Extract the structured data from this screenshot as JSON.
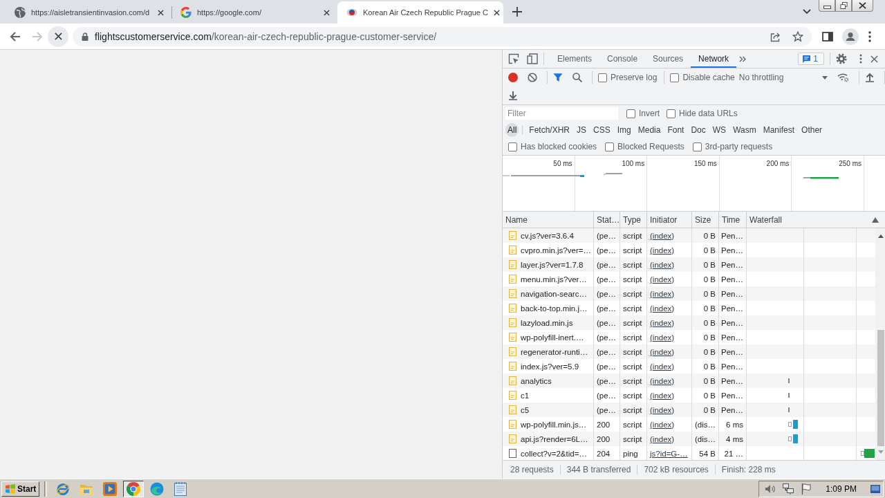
{
  "browser_tabs": [
    {
      "title": "https://aisletransientinvasion.com/d",
      "kind": "globe",
      "selected": false
    },
    {
      "title": "https://google.com/",
      "kind": "google",
      "selected": false
    },
    {
      "title": "Korean Air Czech Republic Prague C",
      "kind": "airline",
      "selected": true
    }
  ],
  "address_bar": {
    "loading": true,
    "host": "flightscustomerservice.com",
    "path": "/korean-air-czech-republic-prague-customer-service/"
  },
  "devtools": {
    "panel_tabs": [
      {
        "label": "Elements",
        "selected": false
      },
      {
        "label": "Console",
        "selected": false
      },
      {
        "label": "Sources",
        "selected": false
      },
      {
        "label": "Network",
        "selected": true
      }
    ],
    "issues_count": "1",
    "recording": true,
    "toolbar_options": [
      {
        "label": "Preserve log",
        "checked": false
      },
      {
        "label": "Disable cache",
        "checked": false
      }
    ],
    "throttling": "No throttling",
    "filter": {
      "placeholder": "Filter",
      "options": [
        {
          "label": "Invert",
          "checked": false
        },
        {
          "label": "Hide data URLs",
          "checked": false
        }
      ]
    },
    "type_filters": [
      {
        "label": "All",
        "selected": true
      },
      {
        "label": "Fetch/XHR",
        "selected": false
      },
      {
        "label": "JS",
        "selected": false
      },
      {
        "label": "CSS",
        "selected": false
      },
      {
        "label": "Img",
        "selected": false
      },
      {
        "label": "Media",
        "selected": false
      },
      {
        "label": "Font",
        "selected": false
      },
      {
        "label": "Doc",
        "selected": false
      },
      {
        "label": "WS",
        "selected": false
      },
      {
        "label": "Wasm",
        "selected": false
      },
      {
        "label": "Manifest",
        "selected": false
      },
      {
        "label": "Other",
        "selected": false
      }
    ],
    "request_filters": [
      {
        "label": "Has blocked cookies",
        "checked": false
      },
      {
        "label": "Blocked Requests",
        "checked": false
      },
      {
        "label": "3rd-party requests",
        "checked": false
      }
    ],
    "overview": {
      "ticks": [
        "50 ms",
        "100 ms",
        "150 ms",
        "200 ms",
        "250 ms"
      ]
    },
    "table": {
      "columns": [
        "Name",
        "Stat…",
        "Type",
        "Initiator",
        "Size",
        "Time",
        "Waterfall"
      ],
      "rows": [
        {
          "kind": "script_file",
          "name": "cv.js?ver=3.6.4",
          "status": "(pe…",
          "type": "script",
          "initiator": "(index)",
          "size": "0 B",
          "time": "Pen…"
        },
        {
          "kind": "script_file",
          "name": "cvpro.min.js?ver=…",
          "status": "(pe…",
          "type": "script",
          "initiator": "(index)",
          "size": "0 B",
          "time": "Pen…"
        },
        {
          "kind": "script_file",
          "name": "layer.js?ver=1.7.8",
          "status": "(pe…",
          "type": "script",
          "initiator": "(index)",
          "size": "0 B",
          "time": "Pen…"
        },
        {
          "kind": "script_file",
          "name": "menu.min.js?ver…",
          "status": "(pe…",
          "type": "script",
          "initiator": "(index)",
          "size": "0 B",
          "time": "Pen…"
        },
        {
          "kind": "script_file",
          "name": "navigation-searc…",
          "status": "(pe…",
          "type": "script",
          "initiator": "(index)",
          "size": "0 B",
          "time": "Pen…"
        },
        {
          "kind": "script_file",
          "name": "back-to-top.min.j…",
          "status": "(pe…",
          "type": "script",
          "initiator": "(index)",
          "size": "0 B",
          "time": "Pen…"
        },
        {
          "kind": "script_file",
          "name": "lazyload.min.js",
          "status": "(pe…",
          "type": "script",
          "initiator": "(index)",
          "size": "0 B",
          "time": "Pen…"
        },
        {
          "kind": "script_file",
          "name": "wp-polyfill-inert.…",
          "status": "(pe…",
          "type": "script",
          "initiator": "(index)",
          "size": "0 B",
          "time": "Pen…"
        },
        {
          "kind": "script_file",
          "name": "regenerator-runti…",
          "status": "(pe…",
          "type": "script",
          "initiator": "(index)",
          "size": "0 B",
          "time": "Pen…"
        },
        {
          "kind": "script_file",
          "name": "index.js?ver=5.9",
          "status": "(pe…",
          "type": "script",
          "initiator": "(index)",
          "size": "0 B",
          "time": "Pen…"
        },
        {
          "kind": "script_file",
          "name": "analytics",
          "status": "(pe…",
          "type": "script",
          "initiator": "(index)",
          "size": "0 B",
          "time": "Pen…",
          "waterfall": {
            "kind": "tick"
          }
        },
        {
          "kind": "script_file",
          "name": "c1",
          "status": "(pe…",
          "type": "script",
          "initiator": "(index)",
          "size": "0 B",
          "time": "Pen…",
          "waterfall": {
            "kind": "tick"
          }
        },
        {
          "kind": "script_file",
          "name": "c5",
          "status": "(pe…",
          "type": "script",
          "initiator": "(index)",
          "size": "0 B",
          "time": "Pen…",
          "waterfall": {
            "kind": "tick"
          }
        },
        {
          "kind": "script_file",
          "name": "wp-polyfill.min.js…",
          "status": "200",
          "type": "script",
          "initiator": "(index)",
          "size": "(dis…",
          "time": "6 ms",
          "waterfall": {
            "kind": "bar"
          }
        },
        {
          "kind": "script_file",
          "name": "api.js?render=6L…",
          "status": "200",
          "type": "script",
          "initiator": "(index)",
          "size": "(dis…",
          "time": "4 ms",
          "waterfall": {
            "kind": "bar"
          }
        },
        {
          "kind": "plain_file",
          "name": "collect?v=2&tid=…",
          "status": "204",
          "type": "ping",
          "initiator": "js?id=G-…",
          "size": "54 B",
          "time": "21 …",
          "waterfall": {
            "kind": "wide_bar"
          }
        }
      ]
    },
    "status_bar": [
      "28 requests",
      "344 B transferred",
      "702 kB resources",
      "Finish: 228 ms"
    ]
  },
  "taskbar": {
    "start": "Start",
    "apps": [
      {
        "kind": "ie",
        "selected": false
      },
      {
        "kind": "explorer",
        "selected": false
      },
      {
        "kind": "media",
        "selected": false
      },
      {
        "kind": "chrome",
        "selected": true
      },
      {
        "kind": "edge",
        "selected": false
      },
      {
        "kind": "notepad",
        "selected": false
      }
    ],
    "clock": "1:09 PM"
  }
}
